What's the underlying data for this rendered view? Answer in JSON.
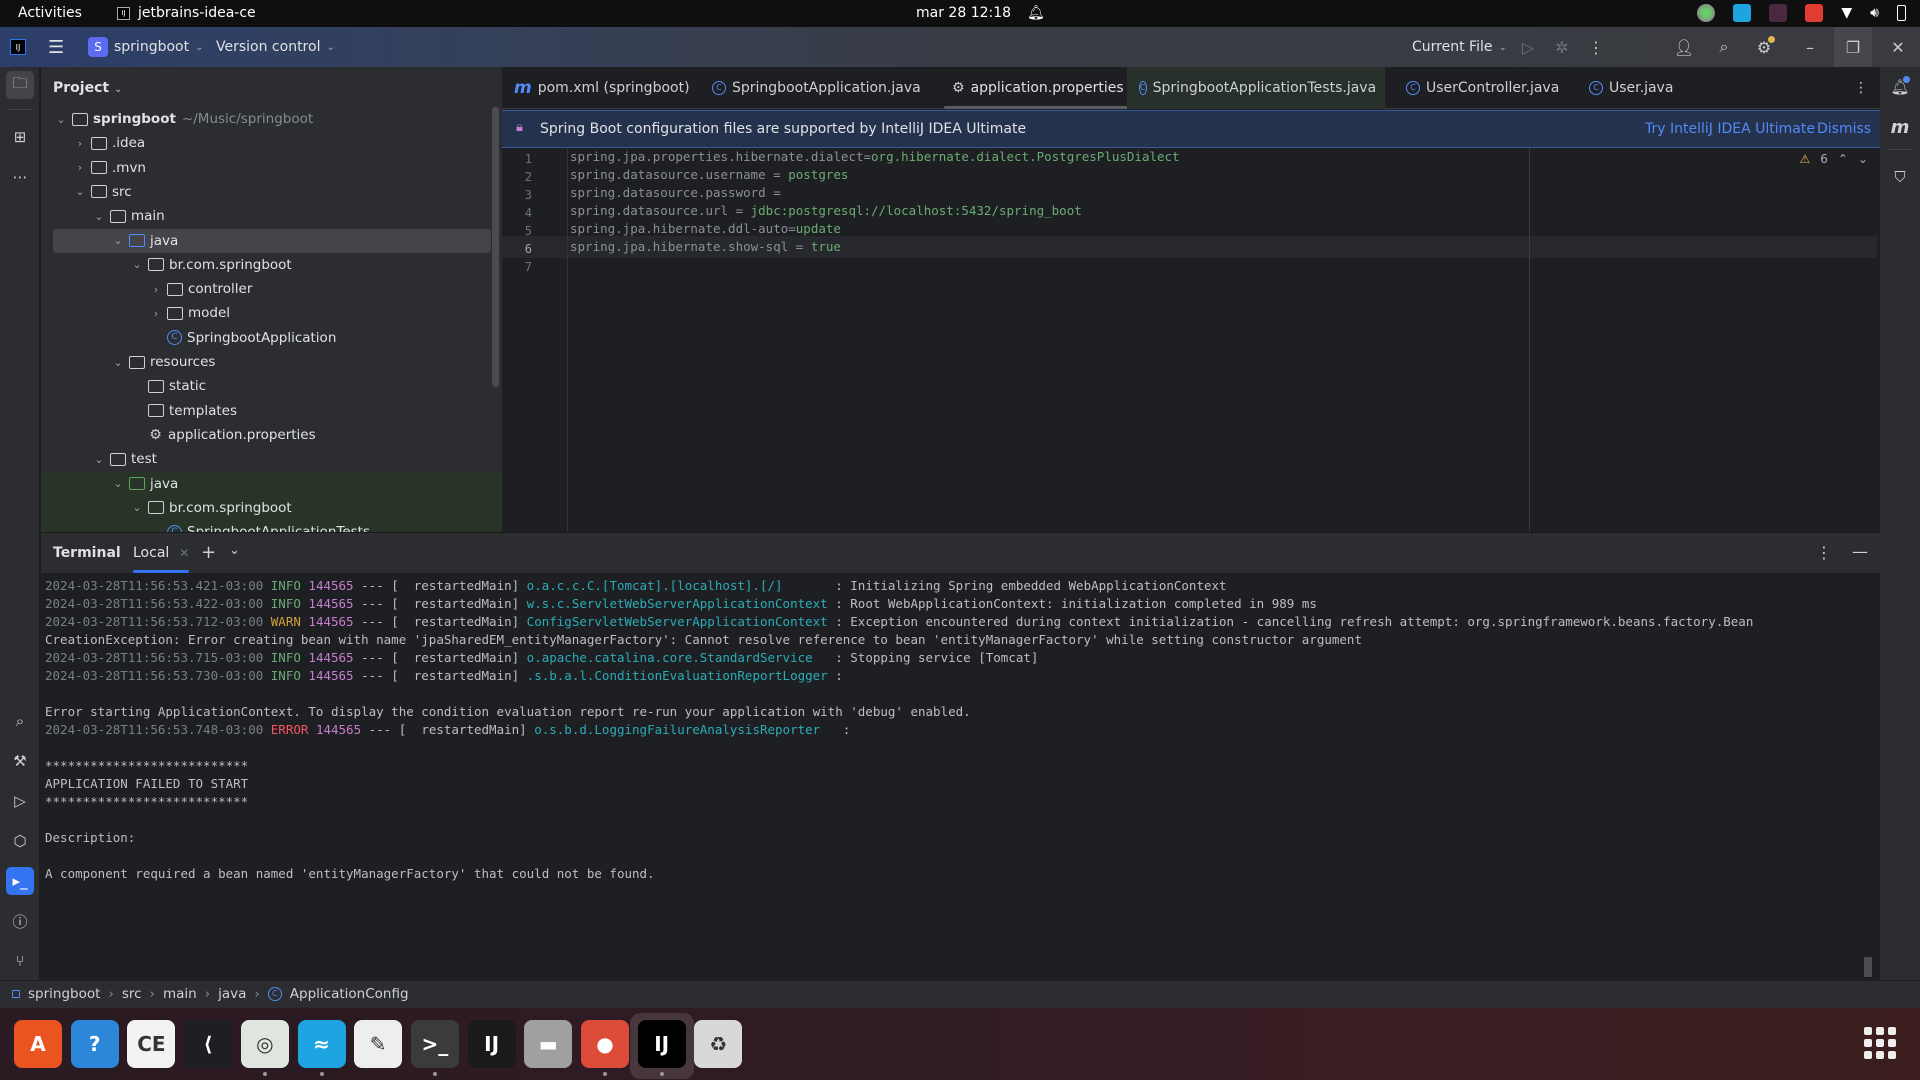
{
  "topbar": {
    "activities": "Activities",
    "app_name": "jetbrains-idea-ce",
    "clock": "mar 28  12:18"
  },
  "titlebar": {
    "logo": "IJ",
    "project_badge": "S",
    "project_name": "springboot",
    "vcs": "Version control",
    "run_config": "Current File"
  },
  "project_panel": {
    "header": "Project",
    "tree": [
      {
        "label": "springboot",
        "extra": "~/Music/springboot",
        "depth": 0,
        "toggle": "open",
        "icon": "module-folder"
      },
      {
        "label": ".idea",
        "depth": 1,
        "toggle": "closed",
        "icon": "folder"
      },
      {
        "label": ".mvn",
        "depth": 1,
        "toggle": "closed",
        "icon": "folder"
      },
      {
        "label": "src",
        "depth": 1,
        "toggle": "open",
        "icon": "folder"
      },
      {
        "label": "main",
        "depth": 2,
        "toggle": "open",
        "icon": "folder"
      },
      {
        "label": "java",
        "depth": 3,
        "toggle": "open",
        "icon": "source-folder",
        "selected": true
      },
      {
        "label": "br.com.springboot",
        "depth": 4,
        "toggle": "open",
        "icon": "package"
      },
      {
        "label": "controller",
        "depth": 5,
        "toggle": "closed",
        "icon": "package"
      },
      {
        "label": "model",
        "depth": 5,
        "toggle": "closed",
        "icon": "package"
      },
      {
        "label": "SpringbootApplication",
        "depth": 5,
        "toggle": "none",
        "icon": "class"
      },
      {
        "label": "resources",
        "depth": 3,
        "toggle": "open",
        "icon": "resources-folder"
      },
      {
        "label": "static",
        "depth": 4,
        "toggle": "none",
        "icon": "folder"
      },
      {
        "label": "templates",
        "depth": 4,
        "toggle": "none",
        "icon": "folder"
      },
      {
        "label": "application.properties",
        "depth": 4,
        "toggle": "none",
        "icon": "properties"
      },
      {
        "label": "test",
        "depth": 2,
        "toggle": "open",
        "icon": "folder"
      },
      {
        "label": "java",
        "depth": 3,
        "toggle": "open",
        "icon": "test-folder",
        "green": true
      },
      {
        "label": "br.com.springboot",
        "depth": 4,
        "toggle": "open",
        "icon": "package",
        "green": true
      },
      {
        "label": "SpringbootApplicationTests",
        "depth": 5,
        "toggle": "none",
        "icon": "class",
        "green": true
      }
    ]
  },
  "tabs": [
    {
      "label": "pom.xml (springboot)",
      "icon": "maven-icon"
    },
    {
      "label": "SpringbootApplication.java",
      "icon": "class-icon"
    },
    {
      "label": "application.properties",
      "icon": "gear-icon",
      "active": true
    },
    {
      "label": "SpringbootApplicationTests.java",
      "icon": "class-icon"
    },
    {
      "label": "UserController.java",
      "icon": "class-icon"
    },
    {
      "label": "User.java",
      "icon": "class-icon"
    }
  ],
  "banner": {
    "text": "Spring Boot configuration files are supported by IntelliJ IDEA Ultimate",
    "try_link": "Try IntelliJ IDEA Ultimate",
    "dismiss": "Dismiss"
  },
  "editor": {
    "warning_count": "6",
    "current_line": 6,
    "lines": [
      {
        "n": "1",
        "key": "spring.jpa.properties.hibernate.dialect=",
        "value": "org.hibernate.dialect.PostgresPlusDialect"
      },
      {
        "n": "2",
        "key": "spring.datasource.username = ",
        "value": "postgres"
      },
      {
        "n": "3",
        "key": "spring.datasource.password = ",
        "value": ""
      },
      {
        "n": "4",
        "key": "spring.datasource.url = ",
        "value": "jdbc:postgresql://localhost:5432/spring_boot"
      },
      {
        "n": "5",
        "key": "spring.jpa.hibernate.ddl-auto=",
        "value": "update"
      },
      {
        "n": "6",
        "key": "spring.jpa.hibernate.show-sql = ",
        "value": "true"
      },
      {
        "n": "7",
        "key": "",
        "value": ""
      }
    ]
  },
  "terminal": {
    "title": "Terminal",
    "tab": "Local",
    "lines": [
      {
        "ts": "2024-03-28T11:56:53.421-03:00",
        "level": "INFO",
        "pid": "144565",
        "thread": " --- [  restartedMain] ",
        "logger": "o.a.c.c.C.[Tomcat].[localhost].[/]      ",
        "msg": " : Initializing Spring embedded WebApplicationContext"
      },
      {
        "ts": "2024-03-28T11:56:53.422-03:00",
        "level": "INFO",
        "pid": "144565",
        "thread": " --- [  restartedMain] ",
        "logger": "w.s.c.ServletWebServerApplicationContext",
        "msg": " : Root WebApplicationContext: initialization completed in 989 ms"
      },
      {
        "ts": "2024-03-28T11:56:53.712-03:00",
        "level": "WARN",
        "pid": "144565",
        "thread": " --- [  restartedMain] ",
        "logger": "ConfigServletWebServerApplicationContext",
        "msg": " : Exception encountered during context initialization - cancelling refresh attempt: org.springframework.beans.factory.Bean"
      },
      {
        "plain": "CreationException: Error creating bean with name 'jpaSharedEM_entityManagerFactory': Cannot resolve reference to bean 'entityManagerFactory' while setting constructor argument"
      },
      {
        "ts": "2024-03-28T11:56:53.715-03:00",
        "level": "INFO",
        "pid": "144565",
        "thread": " --- [  restartedMain] ",
        "logger": "o.apache.catalina.core.StandardService  ",
        "msg": " : Stopping service [Tomcat]"
      },
      {
        "ts": "2024-03-28T11:56:53.730-03:00",
        "level": "INFO",
        "pid": "144565",
        "thread": " --- [  restartedMain] ",
        "logger": ".s.b.a.l.ConditionEvaluationReportLogger",
        "msg": " :"
      },
      {
        "plain": ""
      },
      {
        "plain": "Error starting ApplicationContext. To display the condition evaluation report re-run your application with 'debug' enabled."
      },
      {
        "ts": "2024-03-28T11:56:53.748-03:00",
        "level": "ERROR",
        "pid": "144565",
        "thread": " --- [  restartedMain] ",
        "logger": "o.s.b.d.LoggingFailureAnalysisReporter  ",
        "msg": " :"
      },
      {
        "plain": ""
      },
      {
        "plain": "***************************"
      },
      {
        "plain": "APPLICATION FAILED TO START"
      },
      {
        "plain": "***************************"
      },
      {
        "plain": ""
      },
      {
        "plain": "Description:"
      },
      {
        "plain": ""
      },
      {
        "plain": "A component required a bean named 'entityManagerFactory' that could not be found."
      }
    ]
  },
  "breadcrumb": [
    "springboot",
    "src",
    "main",
    "java",
    "ApplicationConfig"
  ],
  "dock": [
    {
      "name": "app-center",
      "glyph": "A",
      "bg": "#e95420"
    },
    {
      "name": "help",
      "glyph": "?",
      "bg": "#2c87d8"
    },
    {
      "name": "dbeaver",
      "glyph": "CE",
      "bg": "#f2f2f2"
    },
    {
      "name": "vscode",
      "glyph": "⟨",
      "bg": "#1e1f22"
    },
    {
      "name": "cisco-anyconnect",
      "glyph": "◎",
      "bg": "#dfe6e0",
      "running": true
    },
    {
      "name": "zoho",
      "glyph": "≈",
      "bg": "#1ea4e0",
      "running": true
    },
    {
      "name": "text-editor",
      "glyph": "✎",
      "bg": "#eeeeee"
    },
    {
      "name": "terminal",
      "glyph": ">_",
      "bg": "#3b3b3b",
      "running": true
    },
    {
      "name": "intellij-ultimate",
      "glyph": "IJ",
      "bg": "#1a1a1a"
    },
    {
      "name": "files",
      "glyph": "▬",
      "bg": "#a0a0a0"
    },
    {
      "name": "chrome",
      "glyph": "●",
      "bg": "#dd4b39",
      "running": true
    },
    {
      "name": "intellij-ce",
      "glyph": "IJ",
      "bg": "#000000",
      "running": true,
      "active": true
    },
    {
      "name": "trash",
      "glyph": "♻",
      "bg": "#d8d8d8"
    }
  ]
}
